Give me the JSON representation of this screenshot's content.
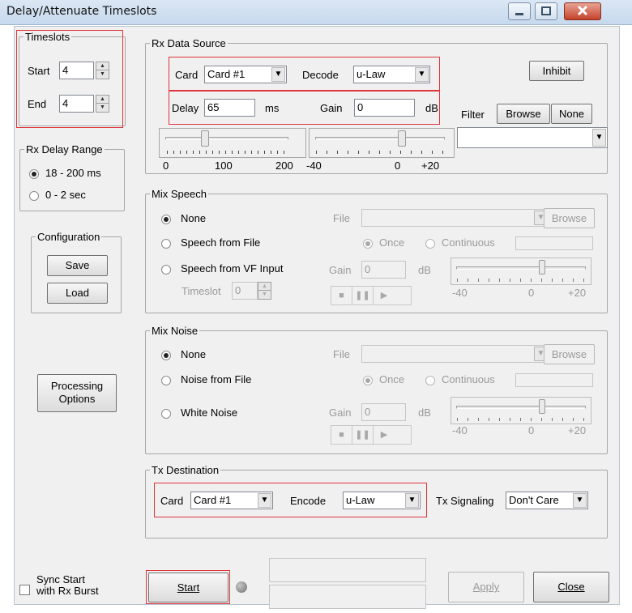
{
  "window": {
    "title": "Delay/Attenuate Timeslots"
  },
  "timeslots": {
    "legend": "Timeslots",
    "start_label": "Start",
    "start_value": "4",
    "end_label": "End",
    "end_value": "4"
  },
  "rx_delay_range": {
    "legend": "Rx Delay Range",
    "option1": "18 - 200 ms",
    "option2": "0 - 2 sec",
    "selected": "18 - 200 ms"
  },
  "configuration": {
    "legend": "Configuration",
    "save": "Save",
    "load": "Load"
  },
  "processing_options": {
    "label_line1": "Processing",
    "label_line2": "Options"
  },
  "rx_data_source": {
    "legend": "Rx Data Source",
    "card_label": "Card",
    "card_value": "Card #1",
    "decode_label": "Decode",
    "decode_value": "u-Law",
    "inhibit": "Inhibit",
    "delay_label": "Delay",
    "delay_value": "65",
    "delay_unit": "ms",
    "gain_label": "Gain",
    "gain_value": "0",
    "gain_unit": "dB",
    "filter_label": "Filter",
    "browse": "Browse",
    "none": "None",
    "filter_value": "",
    "delay_scale": [
      "0",
      "100",
      "200"
    ],
    "gain_scale": [
      "-40",
      "0",
      "+20"
    ],
    "delay_slider_level": 65,
    "gain_slider_level": 0
  },
  "mix_speech": {
    "legend": "Mix Speech",
    "opt_none": "None",
    "opt_file": "Speech from File",
    "opt_vf": "Speech from VF Input",
    "selected": "None",
    "file_label": "File",
    "browse": "Browse",
    "once": "Once",
    "continuous": "Continuous",
    "gain_label": "Gain",
    "gain_value": "0",
    "gain_unit": "dB",
    "timeslot_label": "Timeslot",
    "timeslot_value": "0",
    "scale": [
      "-40",
      "0",
      "+20"
    ]
  },
  "mix_noise": {
    "legend": "Mix Noise",
    "opt_none": "None",
    "opt_file": "Noise from File",
    "opt_white": "White Noise",
    "selected": "None",
    "file_label": "File",
    "browse": "Browse",
    "once": "Once",
    "continuous": "Continuous",
    "gain_label": "Gain",
    "gain_value": "0",
    "gain_unit": "dB",
    "scale": [
      "-40",
      "0",
      "+20"
    ]
  },
  "tx_destination": {
    "legend": "Tx Destination",
    "card_label": "Card",
    "card_value": "Card #1",
    "encode_label": "Encode",
    "encode_value": "u-Law",
    "signaling_label": "Tx Signaling",
    "signaling_value": "Don't Care"
  },
  "footer": {
    "sync_line1": "Sync Start",
    "sync_line2": "with Rx Burst",
    "start": "Start",
    "apply": "Apply",
    "close": "Close"
  },
  "colors": {
    "highlight": "#e0353b",
    "title_bg": "#c6d9ee",
    "dialog_bg": "#f0f0f0"
  }
}
